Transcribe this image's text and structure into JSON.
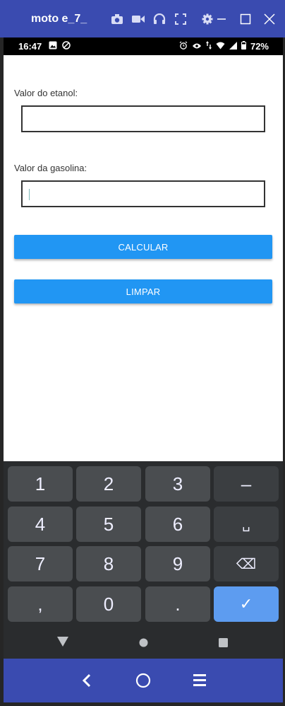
{
  "window": {
    "title": "moto e_7_",
    "icons": [
      "camera-icon",
      "video-icon",
      "headphones-icon",
      "fullscreen-icon",
      "gear-icon"
    ],
    "controls": [
      "minimize-icon",
      "maximize-icon",
      "close-icon"
    ]
  },
  "status_bar": {
    "time": "16:47",
    "battery": "72%"
  },
  "form": {
    "ethanol_label": "Valor do etanol:",
    "ethanol_value": "",
    "gasoline_label": "Valor da gasolina:",
    "gasoline_value": "",
    "calculate_button": "CALCULAR",
    "clear_button": "LIMPAR"
  },
  "keyboard": {
    "rows": [
      [
        "1",
        "2",
        "3",
        "–"
      ],
      [
        "4",
        "5",
        "6",
        "␣"
      ],
      [
        "7",
        "8",
        "9",
        "⌫"
      ],
      [
        ",",
        "0",
        ".",
        "✓"
      ]
    ]
  },
  "colors": {
    "emulator_bar": "#3a4bb0",
    "button": "#2196f3",
    "enter_key": "#5d9cf0"
  }
}
